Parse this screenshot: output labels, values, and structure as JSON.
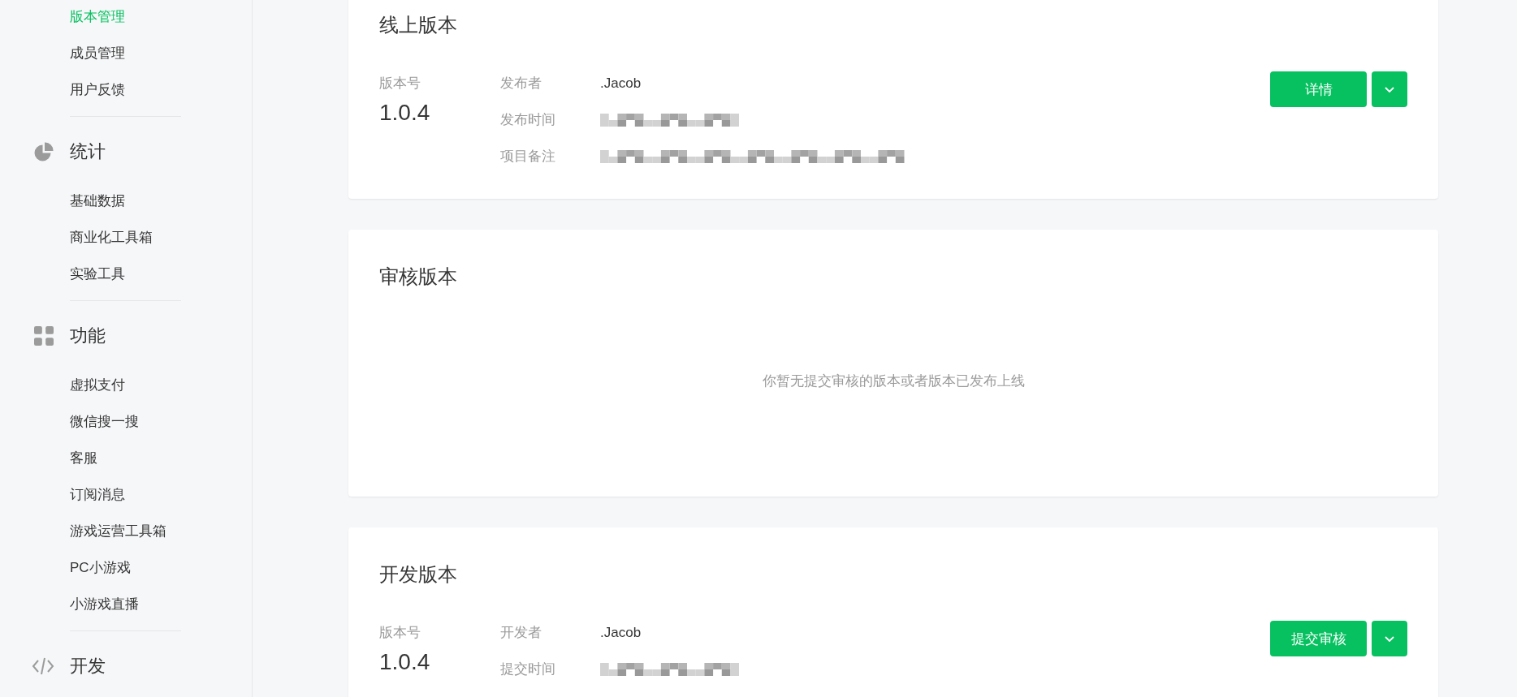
{
  "sidebar": {
    "items": [
      {
        "label": "版本管理",
        "selected": true
      },
      {
        "label": "成员管理",
        "selected": false
      },
      {
        "label": "用户反馈",
        "selected": false
      }
    ],
    "sections": [
      {
        "title": "统计",
        "items": [
          {
            "label": "基础数据",
            "selected": false
          },
          {
            "label": "商业化工具箱",
            "selected": false
          },
          {
            "label": "实验工具",
            "selected": false
          }
        ]
      },
      {
        "title": "功能",
        "items": [
          {
            "label": "虚拟支付",
            "selected": false
          },
          {
            "label": "微信搜一搜",
            "selected": false
          },
          {
            "label": "客服",
            "selected": false
          },
          {
            "label": "订阅消息",
            "selected": false
          },
          {
            "label": "游戏运营工具箱",
            "selected": false
          },
          {
            "label": "PC小游戏",
            "selected": false
          },
          {
            "label": "小游戏直播",
            "selected": false
          }
        ]
      },
      {
        "title": "开发"
      }
    ]
  },
  "cards": [
    {
      "kind": "version",
      "title": "线上版本",
      "version_label": "版本号",
      "version": "1.0.4",
      "fields": [
        {
          "label": "发布者",
          "value": ".Jacob",
          "redacted": false
        },
        {
          "label": "发布时间",
          "redacted": true
        },
        {
          "label": "项目备注",
          "redacted": true
        }
      ],
      "primary_button": "详情"
    },
    {
      "kind": "empty",
      "title": "审核版本",
      "empty_message": "你暂无提交审核的版本或者版本已发布上线"
    },
    {
      "kind": "version",
      "title": "开发版本",
      "version_label": "版本号",
      "version": "1.0.4",
      "fields": [
        {
          "label": "开发者",
          "value": ".Jacob",
          "redacted": false
        },
        {
          "label": "提交时间",
          "redacted": true
        }
      ],
      "primary_button": "提交审核"
    }
  ]
}
